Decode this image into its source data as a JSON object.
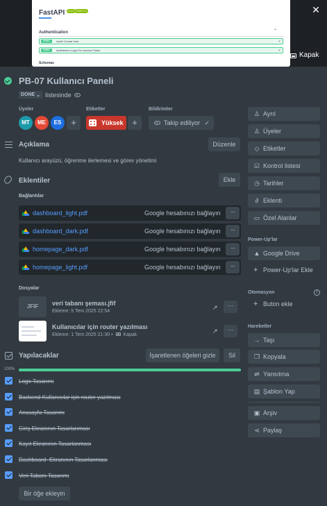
{
  "cover": {
    "thumb_title": "FastAPI",
    "thumb_badge1": "0.1.0",
    "thumb_badge2": "OAS 3.1",
    "thumb_section": "Authentication",
    "thumb_ops": [
      {
        "method": "POST",
        "path": "/auth/    Create User"
      },
      {
        "method": "POST",
        "path": "/auth/token    Login For Access Token"
      }
    ],
    "thumb_schemas": "Schemas",
    "cover_button": "Kapak"
  },
  "card": {
    "title": "PB-07 Kullanıcı Paneli",
    "list_name": "DONE",
    "list_suffix": "listesinde"
  },
  "members": {
    "heading": "Üyeler",
    "avatars": [
      {
        "initials": "MT",
        "color": "#1d9aaa"
      },
      {
        "initials": "ME",
        "color": "#e34935"
      },
      {
        "initials": "ES",
        "color": "#1d6ee0"
      }
    ]
  },
  "labels": {
    "heading": "Etiketler",
    "chip": "Yüksek",
    "chip_color": "#c9372c"
  },
  "notifications": {
    "heading": "Bildirimler",
    "watch_label": "Takip ediliyor"
  },
  "description": {
    "heading": "Açıklama",
    "edit_button": "Düzenle",
    "text": "Kullanıcı arayüzü, öğrenme ilerlemesi ve görev yönetimi"
  },
  "attachments": {
    "heading": "Eklentiler",
    "add_button": "Ekle",
    "links_heading": "Bağlantılar",
    "links": [
      {
        "name": "dashboard_light.pdf",
        "action": "Google hesabınızı bağlayın"
      },
      {
        "name": "dashboard_dark.pdf",
        "action": "Google hesabınızı bağlayın"
      },
      {
        "name": "homepage_dark.pdf",
        "action": "Google hesabınızı bağlayın"
      },
      {
        "name": "homepage_light.pdf",
        "action": "Google hesabınızı bağlayın"
      }
    ],
    "more_label": "···",
    "files_heading": "Dosyalar",
    "files": [
      {
        "thumb_text": "JFIF",
        "name": "veri tabanı şeması.jfif",
        "meta": "Ekleme: 5 Tem 2025 22:54",
        "cover_tag": ""
      },
      {
        "thumb_text": "",
        "name": "Kullanıcılar için router yazılması",
        "meta": "Ekleme: 1 Tem 2025 21:30 •",
        "cover_tag": "Kapak"
      }
    ]
  },
  "checklist": {
    "heading": "Yapılacaklar",
    "hide_button": "İşaretlenen öğeleri gizle",
    "delete_button": "Sil",
    "progress_label": "100%",
    "progress_percent": 100,
    "items": [
      "Logo Tasarımı",
      "Backend-Kullanıcılar için router yazılması",
      "Anasayfa Tasarımı",
      "Giriş Ekranının Tasarlanması",
      "Kayıt Ekranının Tasarlanması",
      "Dashboard- Ekranının Tasarlanması",
      "Veri Tabanı Tasarımı"
    ],
    "add_button": "Bir öğe ekleyin"
  },
  "sidebar": {
    "add_to_card": [
      {
        "label": "Ayrıl",
        "icon": "person-minus-icon"
      },
      {
        "label": "Üyeler",
        "icon": "person-icon"
      },
      {
        "label": "Etiketler",
        "icon": "tag-icon"
      },
      {
        "label": "Kontrol listesi",
        "icon": "checklist-icon"
      },
      {
        "label": "Tarihler",
        "icon": "clock-icon"
      },
      {
        "label": "Eklenti",
        "icon": "paperclip-icon"
      },
      {
        "label": "Özel Alanlar",
        "icon": "custom-fields-icon"
      }
    ],
    "powerups_heading": "Power-Up'lar",
    "powerups": [
      {
        "label": "Google Drive",
        "icon": "google-drive-icon"
      },
      {
        "label": "Power-Up'lar Ekle",
        "icon": "plus-icon"
      }
    ],
    "automation_heading": "Otomasyon",
    "automation_button": "Buton ekle",
    "actions_heading": "Hareketler",
    "actions": [
      {
        "label": "Taşı",
        "icon": "arrow-right-icon"
      },
      {
        "label": "Kopyala",
        "icon": "copy-icon"
      },
      {
        "label": "Yansıtma",
        "icon": "mirror-icon"
      },
      {
        "label": "Şablon Yap",
        "icon": "template-icon"
      }
    ],
    "extra": [
      {
        "label": "Arşiv",
        "icon": "archive-icon"
      },
      {
        "label": "Paylaş",
        "icon": "share-icon"
      }
    ]
  }
}
